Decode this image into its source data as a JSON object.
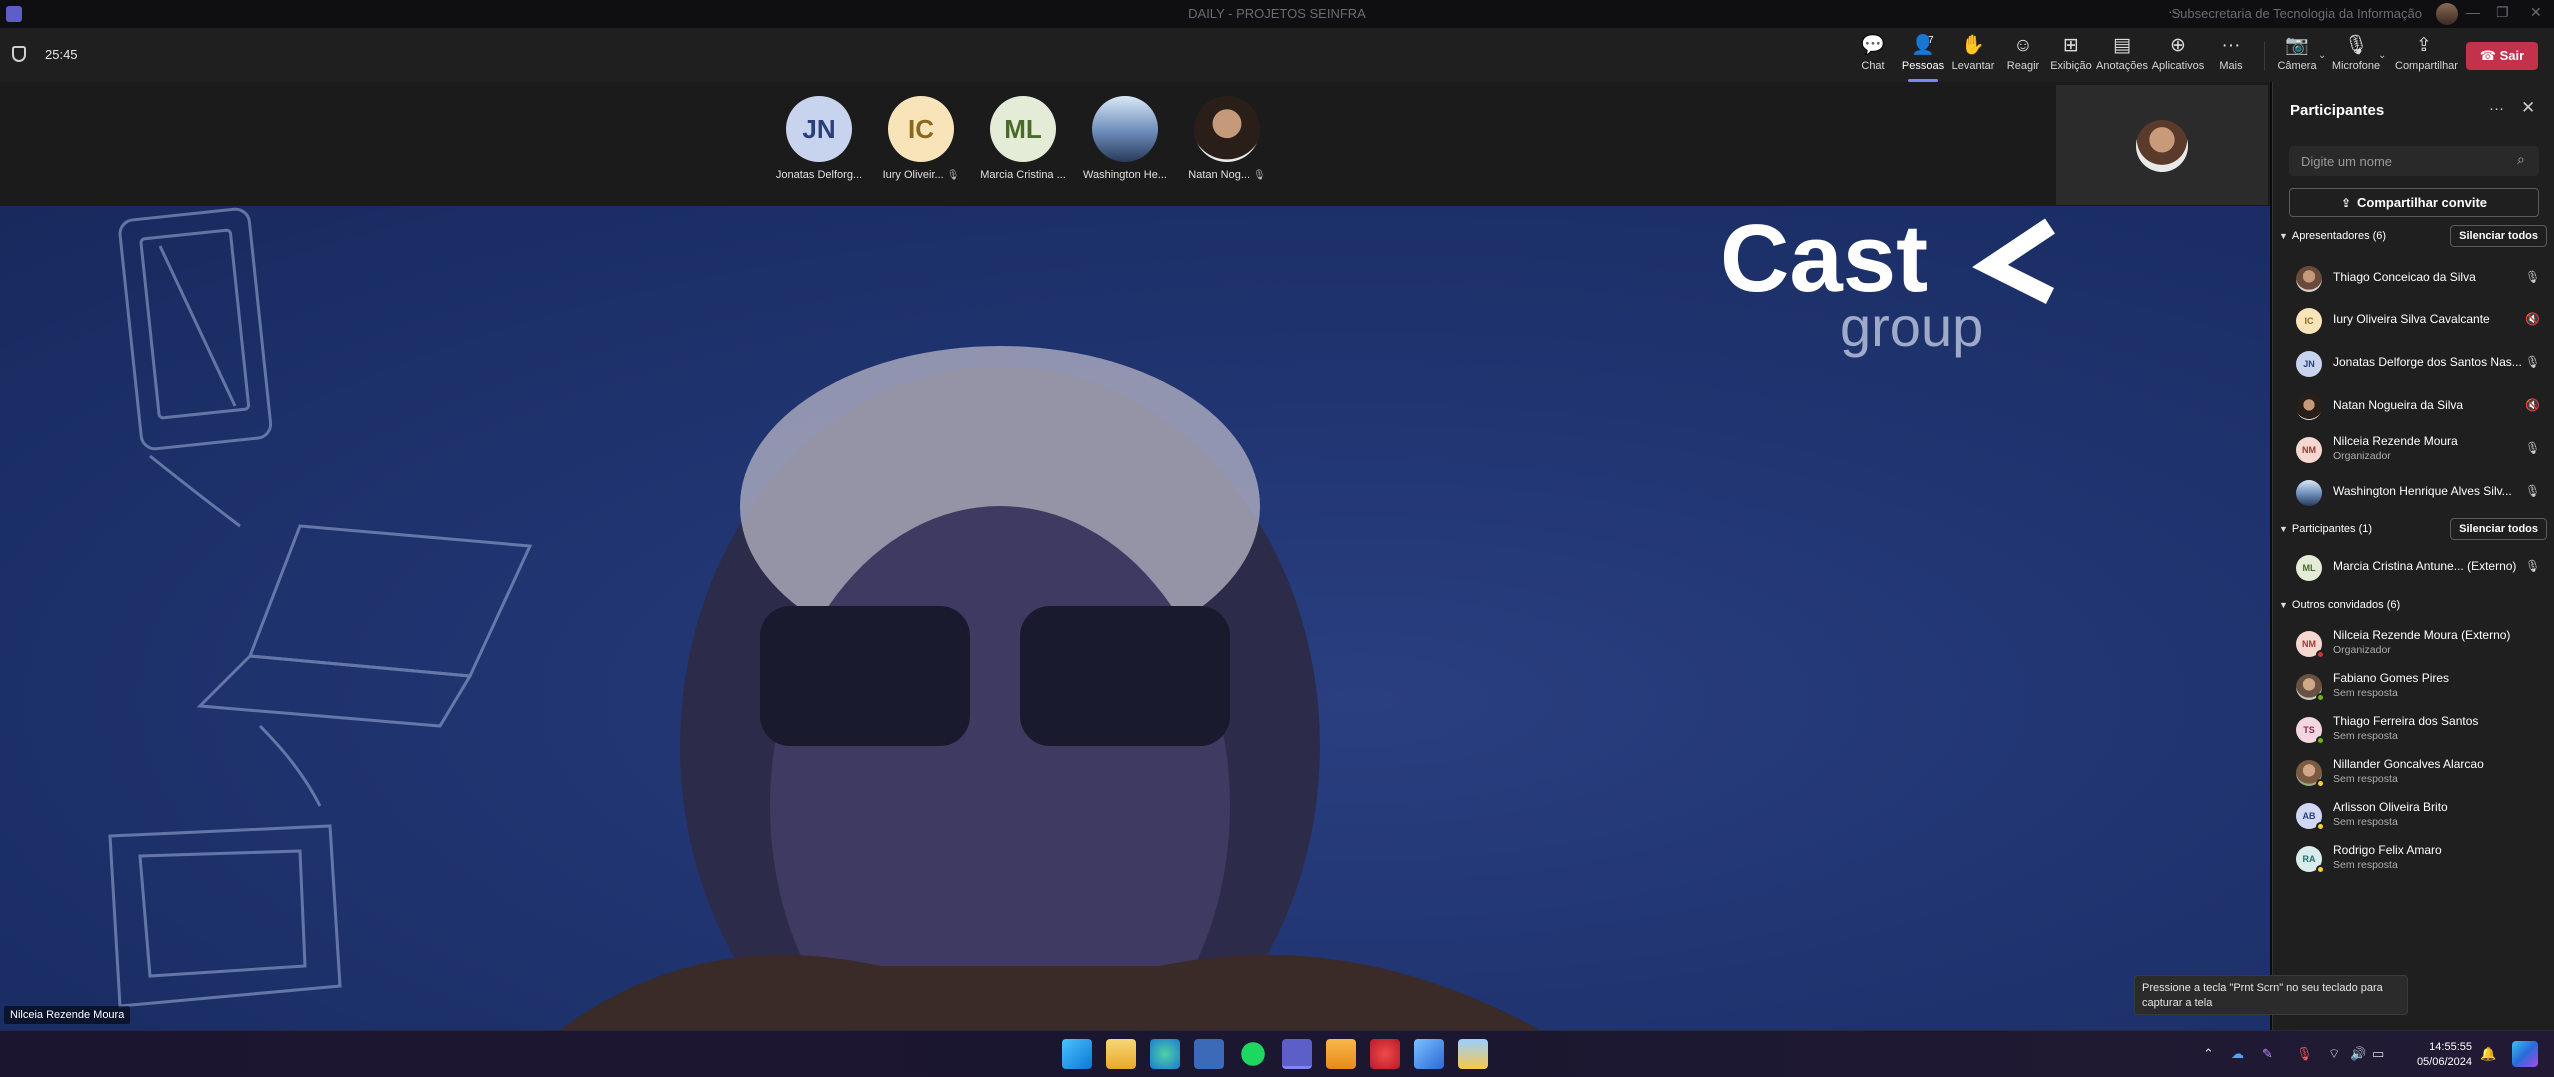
{
  "window": {
    "title": "DAILY - PROJETOS SEINFRA",
    "org": "Subsecretaria de Tecnologia da Informação"
  },
  "toolbar": {
    "timer": "25:45",
    "buttons": [
      {
        "label": "Chat",
        "icon": "chat-icon"
      },
      {
        "label": "Pessoas",
        "icon": "people-icon",
        "count": "7"
      },
      {
        "label": "Levantar",
        "icon": "raise-hand-icon"
      },
      {
        "label": "Reagir",
        "icon": "react-icon"
      },
      {
        "label": "Exibição",
        "icon": "view-icon"
      },
      {
        "label": "Anotações",
        "icon": "notes-icon"
      },
      {
        "label": "Aplicativos",
        "icon": "apps-icon"
      },
      {
        "label": "Mais",
        "icon": "more-icon"
      }
    ],
    "devices": [
      {
        "label": "Câmera",
        "icon": "camera-off-icon"
      },
      {
        "label": "Microfone",
        "icon": "microphone-icon"
      },
      {
        "label": "Compartilhar",
        "icon": "share-icon"
      }
    ],
    "leave_label": "Sair"
  },
  "gallery": [
    {
      "initials": "JN",
      "name": "Jonatas Delforg...",
      "bg": "#c8d3ee",
      "fg": "#2a3f7a",
      "muted": false
    },
    {
      "initials": "IC",
      "name": "Iury Oliveir...",
      "bg": "#f8e4b8",
      "fg": "#8a6a1a",
      "muted": true
    },
    {
      "initials": "ML",
      "name": "Marcia Cristina ...",
      "bg": "#e4ecd8",
      "fg": "#4a6a2a",
      "muted": false
    },
    {
      "initials": "",
      "name": "Washington He...",
      "bg": "#7fa0c8",
      "fg": "#fff",
      "muted": false
    },
    {
      "initials": "",
      "name": "Natan Nog...",
      "bg": "#4a3a30",
      "fg": "#fff",
      "muted": true
    }
  ],
  "main_video": {
    "speaker": "Nilceia Rezende Moura"
  },
  "panel": {
    "title": "Participantes",
    "search_placeholder": "Digite um nome",
    "invite_label": "Compartilhar convite",
    "mute_all_label": "Silenciar todos",
    "presenters_title": "Apresentadores (6)",
    "presenters": [
      {
        "initials": "",
        "name": "Thiago Conceicao da Silva",
        "sub": "",
        "bg": "#7a5a4a",
        "fg": "#fff",
        "mic": "on"
      },
      {
        "initials": "IC",
        "name": "Iury Oliveira Silva Cavalcante",
        "sub": "",
        "bg": "#f8e4b8",
        "fg": "#8a6a1a",
        "mic": "off"
      },
      {
        "initials": "JN",
        "name": "Jonatas Delforge dos Santos Nas...",
        "sub": "",
        "bg": "#c8d3ee",
        "fg": "#2a3f7a",
        "mic": "on"
      },
      {
        "initials": "",
        "name": "Natan Nogueira da Silva",
        "sub": "",
        "bg": "#4a3a30",
        "fg": "#fff",
        "mic": "off"
      },
      {
        "initials": "NM",
        "name": "Nilceia Rezende Moura",
        "sub": "Organizador",
        "bg": "#f6d8d0",
        "fg": "#9a3a2a",
        "mic": "on"
      },
      {
        "initials": "",
        "name": "Washington Henrique Alves Silv...",
        "sub": "",
        "bg": "#7fa0c8",
        "fg": "#fff",
        "mic": "on"
      }
    ],
    "attendees_title": "Participantes (1)",
    "attendees": [
      {
        "initials": "ML",
        "name": "Marcia Cristina Antune...",
        "ext": "(Externo)",
        "bg": "#e4ecd8",
        "fg": "#4a6a2a",
        "mic": "on"
      }
    ],
    "others_title": "Outros convidados (6)",
    "others": [
      {
        "initials": "NM",
        "name": "Nilceia Rezende Moura (Externo)",
        "sub": "Organizador",
        "bg": "#f6d8d0",
        "fg": "#9a3a2a",
        "status": "#d13438"
      },
      {
        "initials": "",
        "name": "Fabiano Gomes Pires",
        "sub": "Sem resposta",
        "bg": "#8a6a50",
        "fg": "#fff",
        "status": "#6bb700"
      },
      {
        "initials": "TS",
        "name": "Thiago Ferreira dos Santos",
        "sub": "Sem resposta",
        "bg": "#f4d6e0",
        "fg": "#8a2a4a",
        "status": "#6bb700"
      },
      {
        "initials": "",
        "name": "Nillander Goncalves Alarcao",
        "sub": "Sem resposta",
        "bg": "#9a7a5a",
        "fg": "#fff",
        "status": "#f8d22a"
      },
      {
        "initials": "AB",
        "name": "Arlisson Oliveira Brito",
        "sub": "Sem resposta",
        "bg": "#d0d8f4",
        "fg": "#2a3f7a",
        "status": "#f8d22a"
      },
      {
        "initials": "RA",
        "name": "Rodrigo Felix Amaro",
        "sub": "Sem resposta",
        "bg": "#d8ecec",
        "fg": "#2a6a6a",
        "status": "#f8d22a"
      }
    ]
  },
  "tooltip": {
    "text": "Pressione a tecla \"Prnt Scrn\" no seu teclado para capturar a tela"
  },
  "taskbar": {
    "time": "14:55:55",
    "date": "05/06/2024"
  }
}
